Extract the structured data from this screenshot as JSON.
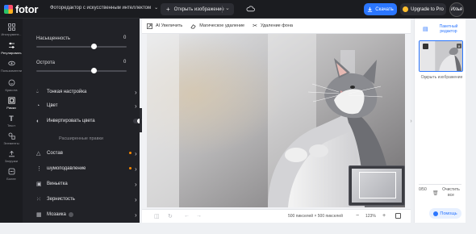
{
  "header": {
    "logo_text": "fotor",
    "editor_title": "Фоторедактор с искусственным интеллектом",
    "open_image_label": "Открыть изображение",
    "download_label": "Скачать",
    "upgrade_label": "Upgrade to Pro",
    "avatar_text": "Илья"
  },
  "rail": {
    "items": [
      {
        "label": "Инструмент...",
        "icon": "grid-icon",
        "active": false
      },
      {
        "label": "Регулировать",
        "icon": "sliders-icon",
        "active": true
      },
      {
        "label": "Пользователи",
        "icon": "eye-icon",
        "active": false
      },
      {
        "label": "Красота",
        "icon": "face-icon",
        "active": false
      },
      {
        "label": "Рамки",
        "icon": "frame-icon",
        "active": false
      },
      {
        "label": "Текст",
        "icon": "text-icon",
        "active": false
      },
      {
        "label": "Элементы",
        "icon": "elements-icon",
        "active": false
      },
      {
        "label": "Загрузки",
        "icon": "upload-icon",
        "active": false
      },
      {
        "label": "Более",
        "icon": "more-icon",
        "active": false
      }
    ]
  },
  "adjust": {
    "saturation_label": "Насыщенность",
    "saturation_value": "0",
    "saturation_level": 0.64,
    "sharpness_label": "Острота",
    "sharpness_value": "0",
    "sharpness_level": 0.64,
    "menu": [
      {
        "label": "Тонкая настройка",
        "icon": "drop-icon"
      },
      {
        "label": "Цвет",
        "icon": "palette-icon"
      },
      {
        "label": "Инвертировать цвета",
        "icon": "invert-icon"
      }
    ],
    "advanced_title": "Расширенные правки",
    "advanced": [
      {
        "label": "Состав",
        "icon": "triangle-icon",
        "pro": true
      },
      {
        "label": "шумоподавление",
        "icon": "noise-icon",
        "pro": true
      },
      {
        "label": "Виньетка",
        "icon": "vignette-icon",
        "pro": false
      },
      {
        "label": "Зернистость",
        "icon": "grain-icon",
        "pro": false
      },
      {
        "label": "Мозаика",
        "icon": "mosaic-icon",
        "pro": false
      }
    ]
  },
  "tools": {
    "ai_enlarge": "AI Увеличить",
    "magic_remove": "Магическое удаление",
    "bg_remove": "Удаление фона"
  },
  "canvas": {
    "size_text": "500 пикселей × 500 пикселей",
    "zoom": "123%"
  },
  "right": {
    "batch_label": "Пакетный редактор",
    "open_image": "Открыть изображение",
    "counter": "0/50",
    "clear_all": "Очистить все"
  },
  "help": {
    "label": "Помощь"
  },
  "colors": {
    "accent": "#2b76ff",
    "dark_bg": "#1b1c20",
    "panel_bg": "#212227",
    "pro_dot": "#ff8a00"
  }
}
